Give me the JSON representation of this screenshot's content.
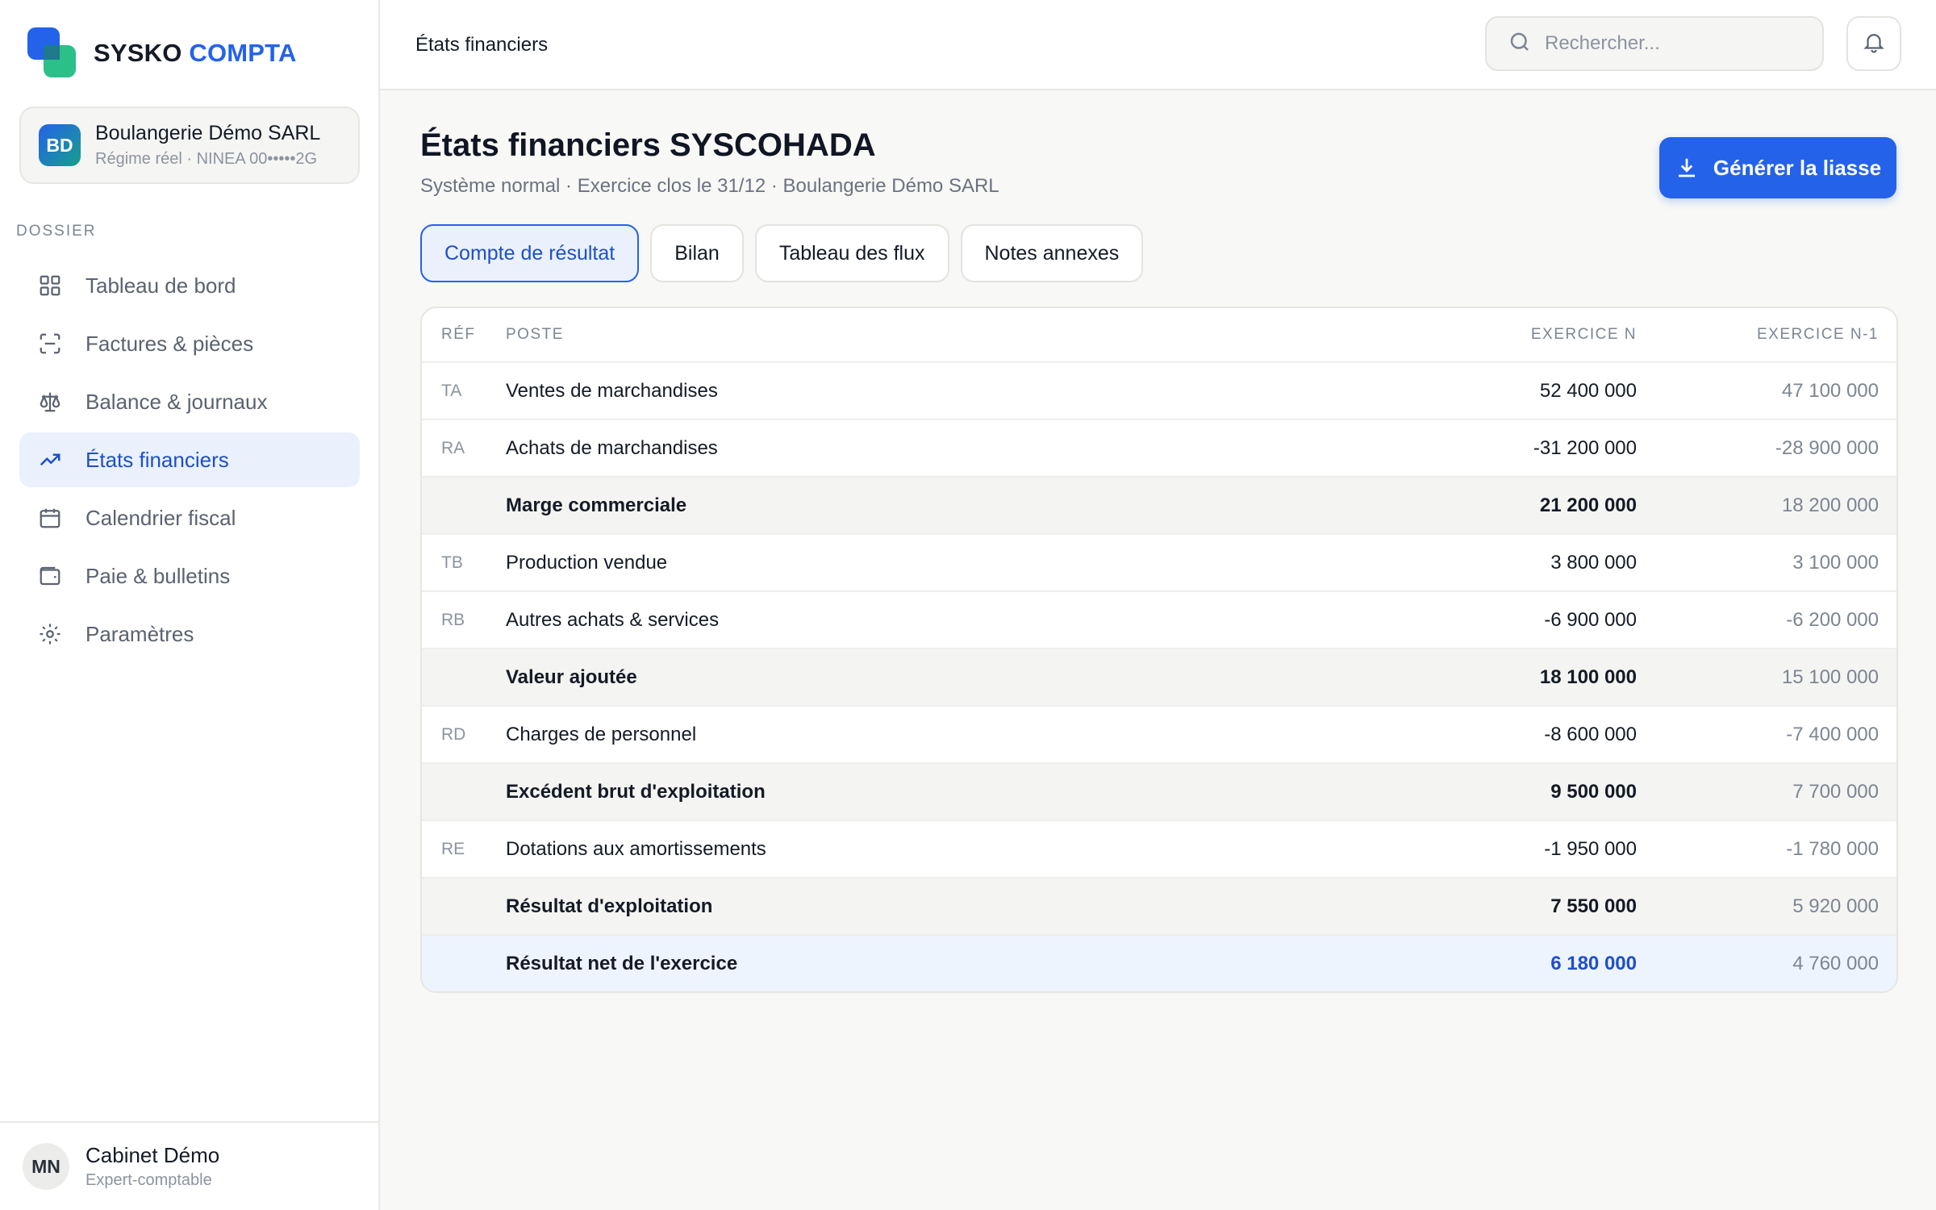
{
  "brand": {
    "part1": "SYSKO",
    "part2": "COMPTA"
  },
  "company": {
    "initials": "BD",
    "name": "Boulangerie Démo SARL",
    "subtitle": "Régime réel · NINEA 00•••••2G"
  },
  "sidebar": {
    "section_label": "DOSSIER",
    "items": [
      {
        "label": "Tableau de bord",
        "icon": "grid-icon"
      },
      {
        "label": "Factures & pièces",
        "icon": "scan-icon"
      },
      {
        "label": "Balance & journaux",
        "icon": "scale-icon"
      },
      {
        "label": "États financiers",
        "icon": "trend-icon",
        "active": true
      },
      {
        "label": "Calendrier fiscal",
        "icon": "calendar-icon"
      },
      {
        "label": "Paie & bulletins",
        "icon": "wallet-icon"
      },
      {
        "label": "Paramètres",
        "icon": "settings-icon"
      }
    ]
  },
  "user": {
    "initials": "MN",
    "name": "Cabinet Démo",
    "role": "Expert-comptable"
  },
  "topbar": {
    "title": "États financiers",
    "search_placeholder": "Rechercher..."
  },
  "page": {
    "title": "États financiers SYSCOHADA",
    "subtitle": "Système normal · Exercice clos le 31/12 · Boulangerie Démo SARL",
    "generate_label": "Générer la liasse"
  },
  "tabs": [
    {
      "label": "Compte de résultat",
      "active": true
    },
    {
      "label": "Bilan"
    },
    {
      "label": "Tableau des flux"
    },
    {
      "label": "Notes annexes"
    }
  ],
  "table": {
    "headers": {
      "ref": "RÉF",
      "poste": "POSTE",
      "n": "EXERCICE N",
      "n1": "EXERCICE N-1"
    },
    "rows": [
      {
        "ref": "TA",
        "poste": "Ventes de marchandises",
        "n": "52 400 000",
        "n1": "47 100 000",
        "type": "normal"
      },
      {
        "ref": "RA",
        "poste": "Achats de marchandises",
        "n": "-31 200 000",
        "n1": "-28 900 000",
        "type": "normal"
      },
      {
        "ref": "",
        "poste": "Marge commerciale",
        "n": "21 200 000",
        "n1": "18 200 000",
        "type": "subtotal"
      },
      {
        "ref": "TB",
        "poste": "Production vendue",
        "n": "3 800 000",
        "n1": "3 100 000",
        "type": "normal"
      },
      {
        "ref": "RB",
        "poste": "Autres achats & services",
        "n": "-6 900 000",
        "n1": "-6 200 000",
        "type": "normal"
      },
      {
        "ref": "",
        "poste": "Valeur ajoutée",
        "n": "18 100 000",
        "n1": "15 100 000",
        "type": "subtotal"
      },
      {
        "ref": "RD",
        "poste": "Charges de personnel",
        "n": "-8 600 000",
        "n1": "-7 400 000",
        "type": "normal"
      },
      {
        "ref": "",
        "poste": "Excédent brut d'exploitation",
        "n": "9 500 000",
        "n1": "7 700 000",
        "type": "subtotal"
      },
      {
        "ref": "RE",
        "poste": "Dotations aux amortissements",
        "n": "-1 950 000",
        "n1": "-1 780 000",
        "type": "normal"
      },
      {
        "ref": "",
        "poste": "Résultat d'exploitation",
        "n": "7 550 000",
        "n1": "5 920 000",
        "type": "subtotal"
      },
      {
        "ref": "",
        "poste": "Résultat net de l'exercice",
        "n": "6 180 000",
        "n1": "4 760 000",
        "type": "final"
      }
    ]
  },
  "colors": {
    "accent": "#2462ea",
    "accent_text": "#1e4fc9",
    "accent_bg": "#eaf1fd",
    "secondary": "#2bbf8a"
  }
}
